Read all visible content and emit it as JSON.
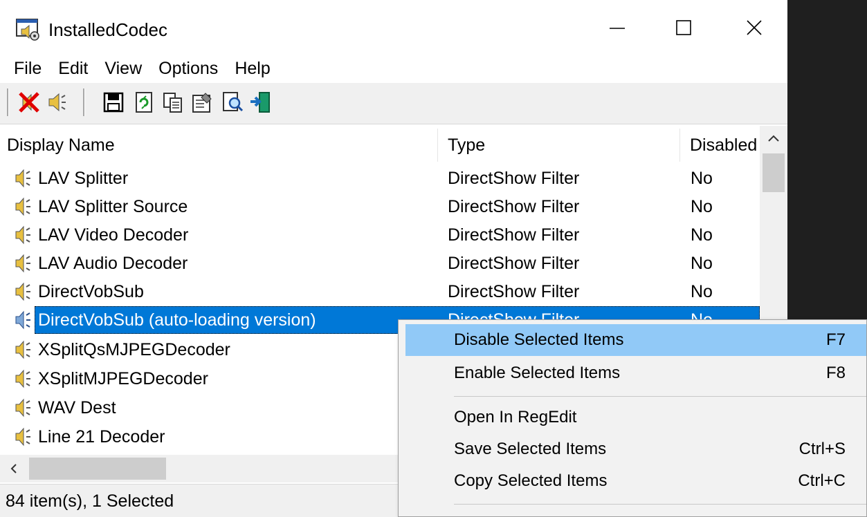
{
  "window": {
    "title": "InstalledCodec"
  },
  "menu": [
    "File",
    "Edit",
    "View",
    "Options",
    "Help"
  ],
  "toolbar": {
    "buttons": [
      "disable-icon",
      "enable-icon",
      "save-icon",
      "refresh-icon",
      "copy-icon",
      "properties-icon",
      "find-icon",
      "exit-icon"
    ]
  },
  "columns": [
    "Display Name",
    "Type",
    "Disabled"
  ],
  "rows": [
    {
      "name": "LAV Splitter",
      "type": "DirectShow Filter",
      "disabled": "No"
    },
    {
      "name": "LAV Splitter Source",
      "type": "DirectShow Filter",
      "disabled": "No"
    },
    {
      "name": "LAV Video Decoder",
      "type": "DirectShow Filter",
      "disabled": "No"
    },
    {
      "name": "LAV Audio Decoder",
      "type": "DirectShow Filter",
      "disabled": "No"
    },
    {
      "name": "DirectVobSub",
      "type": "DirectShow Filter",
      "disabled": "No"
    },
    {
      "name": "DirectVobSub (auto-loading version)",
      "type": "DirectShow Filter",
      "disabled": "No",
      "selected": true
    },
    {
      "name": "XSplitQsMJPEGDecoder",
      "type": "",
      "disabled": ""
    },
    {
      "name": "XSplitMJPEGDecoder",
      "type": "",
      "disabled": ""
    },
    {
      "name": "WAV Dest",
      "type": "",
      "disabled": ""
    },
    {
      "name": "Line 21 Decoder",
      "type": "",
      "disabled": ""
    }
  ],
  "status": "84 item(s), 1 Selected",
  "context_menu": {
    "items": [
      {
        "label": "Disable Selected Items",
        "shortcut": "F7",
        "highlighted": true
      },
      {
        "label": "Enable Selected Items",
        "shortcut": "F8"
      },
      {
        "label": "Open In RegEdit",
        "shortcut": ""
      },
      {
        "label": "Save Selected Items",
        "shortcut": "Ctrl+S"
      },
      {
        "label": "Copy Selected Items",
        "shortcut": "Ctrl+C"
      }
    ]
  },
  "colors": {
    "selection": "#0078d7",
    "menu_highlight": "#91c9f7"
  }
}
